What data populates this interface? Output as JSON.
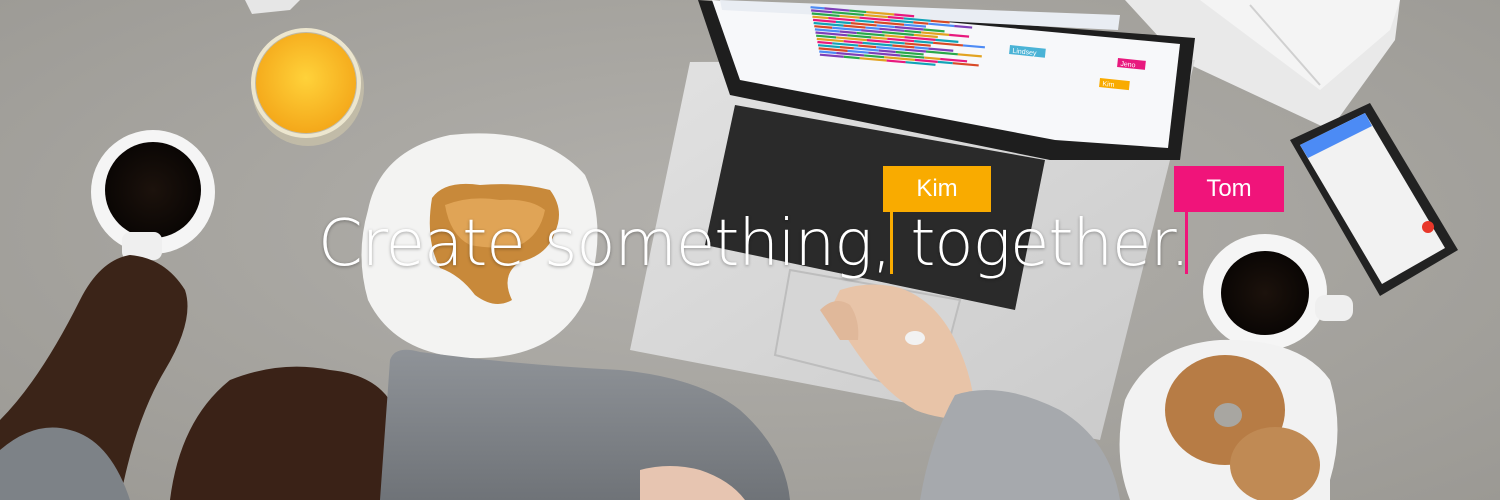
{
  "headline": "Create something, together.",
  "collaborators": [
    {
      "name": "Kim",
      "color": "#f9ab00"
    },
    {
      "name": "Tom",
      "color": "#f0147a"
    }
  ],
  "laptop_screen": {
    "tags": [
      {
        "name": "Lindsey",
        "color": "#4ab3d6"
      },
      {
        "name": "Jeno",
        "color": "#e8197e"
      },
      {
        "name": "Kim",
        "color": "#f9ab00"
      }
    ]
  },
  "colors": {
    "table": "#a8a6a1",
    "bar_palette": [
      "#4d8bf5",
      "#7e3fb8",
      "#2aa84a",
      "#e2a321",
      "#e8197e",
      "#12a3b7",
      "#d84a27"
    ]
  }
}
